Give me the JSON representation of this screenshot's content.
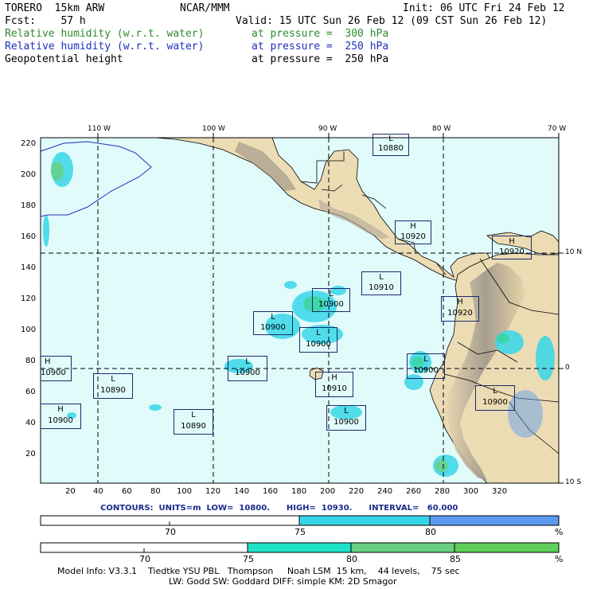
{
  "header": {
    "model": "TORERO  15km ARW",
    "org": "NCAR/MMM",
    "init": "Init: 06 UTC Fri 24 Feb 12",
    "fcst": "Fcst:    57 h",
    "valid": "Valid: 15 UTC Sun 26 Feb 12 (09 CST Sun 26 Feb 12)",
    "fields": [
      {
        "name": "Relative humidity (w.r.t. water)",
        "level": "at pressure =  300 hPa",
        "color": "#2e8b2e"
      },
      {
        "name": "Relative humidity (w.r.t. water)",
        "level": "at pressure =  250 hPa",
        "color": "#1f2fbf"
      },
      {
        "name": "Geopotential height",
        "level": "at pressure =  250 hPa",
        "color": "#000000"
      }
    ]
  },
  "map": {
    "lon_labels": [
      "110 W",
      "100 W",
      "90 W",
      "80 W",
      "70 W"
    ],
    "lat_labels": [
      "10 N",
      "0",
      "10 S"
    ],
    "x_ticks": [
      "20",
      "40",
      "60",
      "80",
      "100",
      "120",
      "140",
      "160",
      "180",
      "200",
      "220",
      "240",
      "260",
      "280",
      "300",
      "320"
    ],
    "y_ticks": [
      "220",
      "200",
      "180",
      "160",
      "140",
      "120",
      "100",
      "80",
      "60",
      "40",
      "20"
    ],
    "height_labels": [
      {
        "type": "L",
        "value": "10880"
      },
      {
        "type": "H",
        "value": "10920"
      },
      {
        "type": "H",
        "value": "10920"
      },
      {
        "type": "L",
        "value": "10910"
      },
      {
        "type": "L",
        "value": "10900"
      },
      {
        "type": "H",
        "value": "10920"
      },
      {
        "type": "L",
        "value": "10900"
      },
      {
        "type": "L",
        "value": "10900"
      },
      {
        "type": "H",
        "value": "10900"
      },
      {
        "type": "L",
        "value": "10900"
      },
      {
        "type": "L",
        "value": "10900"
      },
      {
        "type": "H",
        "value": "10910"
      },
      {
        "type": "L",
        "value": "10890"
      },
      {
        "type": "L",
        "value": "10900"
      },
      {
        "type": "H",
        "value": "10900"
      },
      {
        "type": "L",
        "value": "10890"
      },
      {
        "type": "L",
        "value": "10900"
      }
    ]
  },
  "contours": "CONTOURS:  UNITS=m  LOW=  10800.      HIGH=  10930.      INTERVAL=   60.000",
  "colorbar_250": {
    "labels": [
      "70",
      "75",
      "80",
      "%"
    ],
    "colors": [
      "#ffffff",
      "#36d6e8",
      "#5a9af0"
    ]
  },
  "colorbar_300": {
    "labels": [
      "70",
      "75",
      "80",
      "85",
      "%"
    ],
    "colors": [
      "#ffffff",
      "#1ee3c8",
      "#3ad49a",
      "#6acf80",
      "#5fcf5a"
    ]
  },
  "footer": {
    "line1": "Model Info: V3.3.1    Tiedtke YSU PBL   Thompson     Noah LSM  15 km,    44 levels,    75 sec",
    "line2": "LW: Godd SW: Goddard DIFF: simple KM: 2D Smagor"
  }
}
